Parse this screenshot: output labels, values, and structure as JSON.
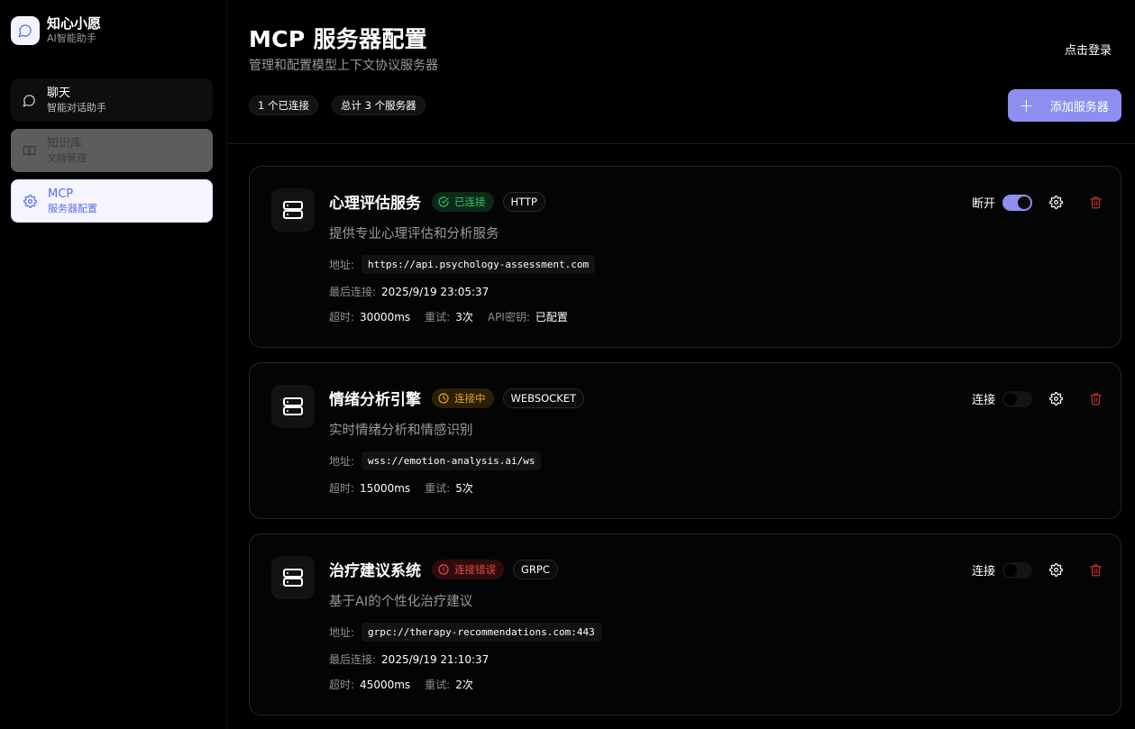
{
  "brand": {
    "name": "知心小愿",
    "subtitle": "AI智能助手"
  },
  "sidebar": {
    "items": [
      {
        "label": "聊天",
        "sub": "智能对话助手",
        "icon": "chat-bubble-icon"
      },
      {
        "label": "知识库",
        "sub": "文档管理",
        "icon": "book-icon"
      },
      {
        "label": "MCP",
        "sub": "服务器配置",
        "icon": "gear-icon",
        "active": true
      }
    ]
  },
  "header": {
    "title": "MCP 服务器配置",
    "subtitle": "管理和配置模型上下文协议服务器",
    "login": "点击登录",
    "connected_chip": "1 个已连接",
    "total_chip": "总计 3 个服务器",
    "add_button": "添加服务器"
  },
  "labels": {
    "address": "地址:",
    "last_connected": "最后连接:",
    "timeout": "超时:",
    "retry": "重试:",
    "api_key": "API密钥:"
  },
  "colors": {
    "accent": "#8c8ff0",
    "status_ok": "#36c06a",
    "status_pending": "#e3a126",
    "status_error": "#e5484d",
    "delete": "#c03030"
  },
  "servers": [
    {
      "name": "心理评估服务",
      "status": "已连接",
      "status_kind": "ok",
      "protocol": "HTTP",
      "description": "提供专业心理评估和分析服务",
      "address": "https://api.psychology-assessment.com",
      "last_connected": "2025/9/19 23:05:37",
      "timeout": "30000ms",
      "retry": "3次",
      "api_key": "已配置",
      "toggle_label": "断开",
      "toggle_on": true
    },
    {
      "name": "情绪分析引擎",
      "status": "连接中",
      "status_kind": "pending",
      "protocol": "WEBSOCKET",
      "description": "实时情绪分析和情感识别",
      "address": "wss://emotion-analysis.ai/ws",
      "timeout": "15000ms",
      "retry": "5次",
      "toggle_label": "连接",
      "toggle_on": false
    },
    {
      "name": "治疗建议系统",
      "status": "连接错误",
      "status_kind": "error",
      "protocol": "GRPC",
      "description": "基于AI的个性化治疗建议",
      "address": "grpc://therapy-recommendations.com:443",
      "last_connected": "2025/9/19 21:10:37",
      "timeout": "45000ms",
      "retry": "2次",
      "toggle_label": "连接",
      "toggle_on": false
    }
  ]
}
